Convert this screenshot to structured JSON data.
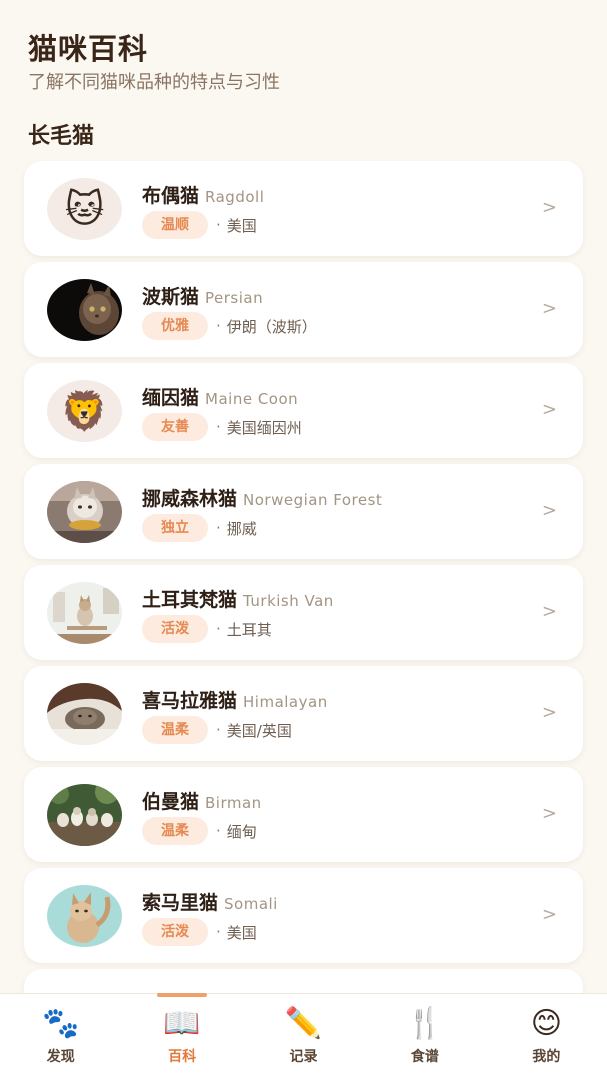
{
  "header": {
    "title": "猫咪百科",
    "subtitle": "了解不同猫咪品种的特点与习性"
  },
  "section": {
    "title": "长毛猫"
  },
  "breeds": [
    {
      "cn": "布偶猫",
      "en": "Ragdoll",
      "tag": "温顺",
      "origin": "美国",
      "avatar": "cat-face-emoji"
    },
    {
      "cn": "波斯猫",
      "en": "Persian",
      "tag": "优雅",
      "origin": "伊朗（波斯）",
      "avatar": "photo-persian-cat"
    },
    {
      "cn": "缅因猫",
      "en": "Maine Coon",
      "tag": "友善",
      "origin": "美国缅因州",
      "avatar": "lion-face-emoji"
    },
    {
      "cn": "挪威森林猫",
      "en": "Norwegian Forest",
      "tag": "独立",
      "origin": "挪威",
      "avatar": "photo-norwegian-forest-cat"
    },
    {
      "cn": "土耳其梵猫",
      "en": "Turkish Van",
      "tag": "活泼",
      "origin": "土耳其",
      "avatar": "photo-turkish-van-cat"
    },
    {
      "cn": "喜马拉雅猫",
      "en": "Himalayan",
      "tag": "温柔",
      "origin": "美国/英国",
      "avatar": "photo-himalayan-cat"
    },
    {
      "cn": "伯曼猫",
      "en": "Birman",
      "tag": "温柔",
      "origin": "缅甸",
      "avatar": "photo-birman-cats"
    },
    {
      "cn": "索马里猫",
      "en": "Somali",
      "tag": "活泼",
      "origin": "美国",
      "avatar": "photo-somali-cat"
    }
  ],
  "emoji": {
    "cat": "🐱",
    "lion": "🦁"
  },
  "list_separator": "·",
  "chevron": ">",
  "nav": [
    {
      "label": "发现",
      "icon": "🐾",
      "icon_name": "paw-icon",
      "active": false
    },
    {
      "label": "百科",
      "icon": "📖",
      "icon_name": "book-icon",
      "active": true
    },
    {
      "label": "记录",
      "icon": "✏️",
      "icon_name": "pencil-icon",
      "active": false
    },
    {
      "label": "食谱",
      "icon": "🍴",
      "icon_name": "fork-knife-icon",
      "active": false
    },
    {
      "label": "我的",
      "icon": "😊",
      "icon_name": "smile-icon",
      "active": false
    }
  ],
  "colors": {
    "background": "#fbf7f1",
    "accent": "#e07a3b",
    "tag_bg": "#fdebdf",
    "tag_text": "#e58a52"
  }
}
